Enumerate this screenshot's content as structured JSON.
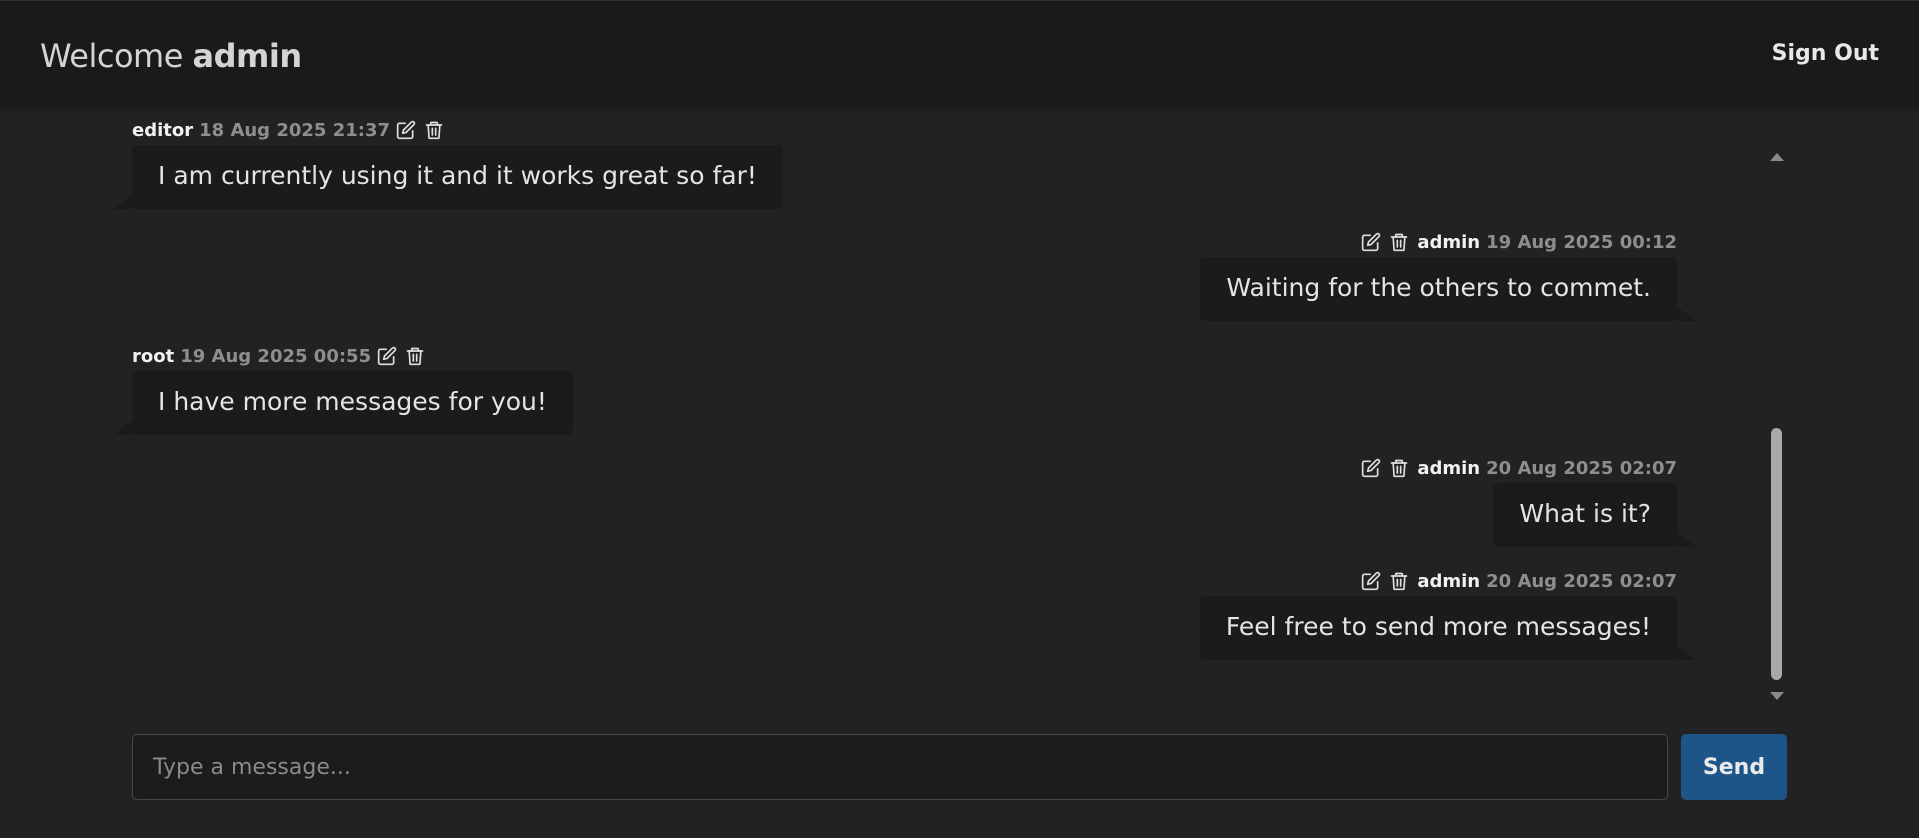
{
  "header": {
    "welcome_prefix": "Welcome",
    "username": "admin",
    "sign_out_label": "Sign Out"
  },
  "messages": [
    {
      "author": "editor",
      "time": "18 Aug 2025 21:37",
      "text": "I am currently using it and it works great so far!",
      "side": "left"
    },
    {
      "author": "admin",
      "time": "19 Aug 2025 00:12",
      "text": "Waiting for the others to commet.",
      "side": "right"
    },
    {
      "author": "root",
      "time": "19 Aug 2025 00:55",
      "text": "I have more messages for you!",
      "side": "left"
    },
    {
      "author": "admin",
      "time": "20 Aug 2025 02:07",
      "text": "What is it?",
      "side": "right"
    },
    {
      "author": "admin",
      "time": "20 Aug 2025 02:07",
      "text": "Feel free to send more messages!",
      "side": "right"
    }
  ],
  "icons": {
    "edit": "edit-icon",
    "delete": "trash-icon"
  },
  "composer": {
    "placeholder": "Type a message...",
    "value": "",
    "send_label": "Send"
  },
  "colors": {
    "background": "#222222",
    "header": "#1a1a1a",
    "bubble": "#1b1b1b",
    "send_button": "#1e5589",
    "timestamp": "#8e8e8e"
  }
}
